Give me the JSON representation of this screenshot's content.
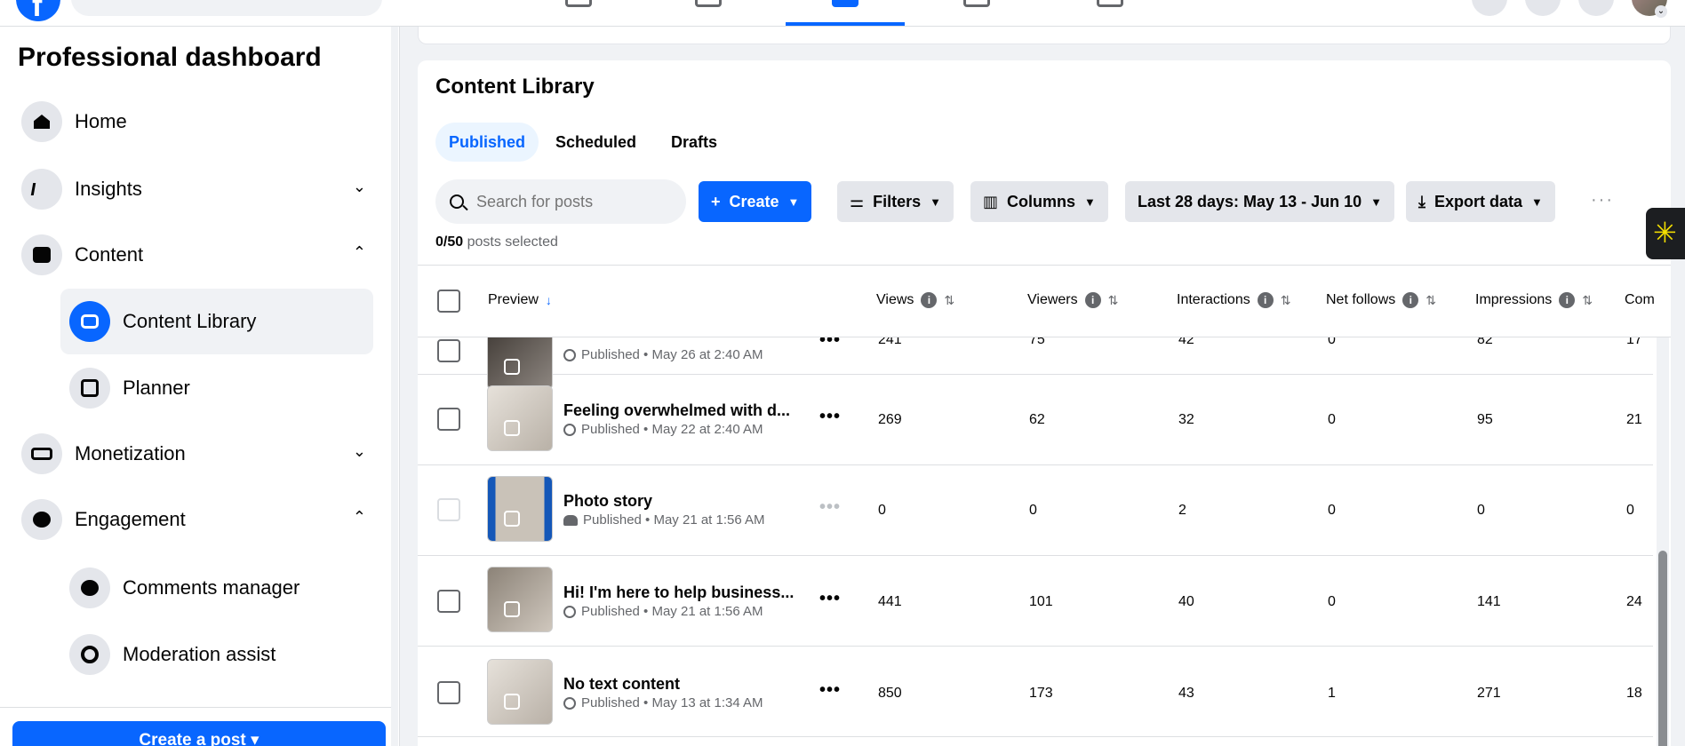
{
  "sidebar": {
    "title": "Professional dashboard",
    "items": [
      {
        "label": "Home",
        "icon": "home-icon"
      },
      {
        "label": "Insights",
        "icon": "insights-icon",
        "chevron": "⌄"
      },
      {
        "label": "Content",
        "icon": "content-icon",
        "chevron": "⌃"
      },
      {
        "label": "Monetization",
        "icon": "monetization-icon",
        "chevron": "⌄"
      },
      {
        "label": "Engagement",
        "icon": "engagement-icon",
        "chevron": "⌃"
      }
    ],
    "content_sub": [
      {
        "label": "Content Library",
        "icon": "content-library-icon",
        "active": true
      },
      {
        "label": "Planner",
        "icon": "planner-icon"
      }
    ],
    "engagement_sub": [
      {
        "label": "Comments manager",
        "icon": "comments-icon"
      },
      {
        "label": "Moderation assist",
        "icon": "moderation-icon"
      }
    ],
    "create_post": "Create a post"
  },
  "content_library": {
    "title": "Content Library",
    "tabs": [
      "Published",
      "Scheduled",
      "Drafts"
    ],
    "active_tab": "Published",
    "search_placeholder": "Search for posts",
    "create_label": "Create",
    "filters_label": "Filters",
    "columns_label": "Columns",
    "date_range_label": "Last 28 days: May 13 - Jun 10",
    "export_label": "Export data",
    "selected_count": "0/50",
    "selected_suffix": "posts selected"
  },
  "table": {
    "headers": [
      "Preview",
      "Views",
      "Viewers",
      "Interactions",
      "Net follows",
      "Impressions",
      "Com"
    ],
    "rows": [
      {
        "title": "",
        "status": "Published • May 26 at 2:40 AM",
        "views": "241",
        "viewers": "75",
        "interactions": "42",
        "net_follows": "0",
        "impressions": "82",
        "comments": "17"
      },
      {
        "title": "Feeling overwhelmed with d...",
        "status": "Published • May 22 at 2:40 AM",
        "views": "269",
        "viewers": "62",
        "interactions": "32",
        "net_follows": "0",
        "impressions": "95",
        "comments": "21"
      },
      {
        "title": "Photo story",
        "status": "Published • May 21 at 1:56 AM",
        "views": "0",
        "viewers": "0",
        "interactions": "2",
        "net_follows": "0",
        "impressions": "0",
        "comments": "0"
      },
      {
        "title": "Hi! I'm here to help business...",
        "status": "Published • May 21 at 1:56 AM",
        "views": "441",
        "viewers": "101",
        "interactions": "40",
        "net_follows": "0",
        "impressions": "141",
        "comments": "24"
      },
      {
        "title": "No text content",
        "status": "Published • May 13 at 1:34 AM",
        "views": "850",
        "viewers": "173",
        "interactions": "43",
        "net_follows": "1",
        "impressions": "271",
        "comments": "18"
      }
    ]
  },
  "colors": {
    "accent": "#0866ff",
    "background": "#f0f2f5",
    "widget": "#f5e000"
  }
}
